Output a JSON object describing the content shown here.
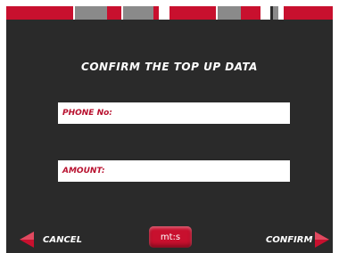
{
  "title": "CONFIRM THE TOP UP DATA",
  "fields": {
    "phone_label": "PHONE No:",
    "phone_value": "",
    "amount_label": "AMOUNT:",
    "amount_value": ""
  },
  "actions": {
    "cancel_label": "CANCEL",
    "confirm_label": "CONFIRM"
  },
  "logo": {
    "text": "mt:s"
  },
  "colors": {
    "accent_red": "#c8102e",
    "panel_bg": "#2a2a2a",
    "bar_gray": "#8a8a8a"
  },
  "icons": {
    "back": "arrow-left-icon",
    "forward": "arrow-right-icon"
  }
}
